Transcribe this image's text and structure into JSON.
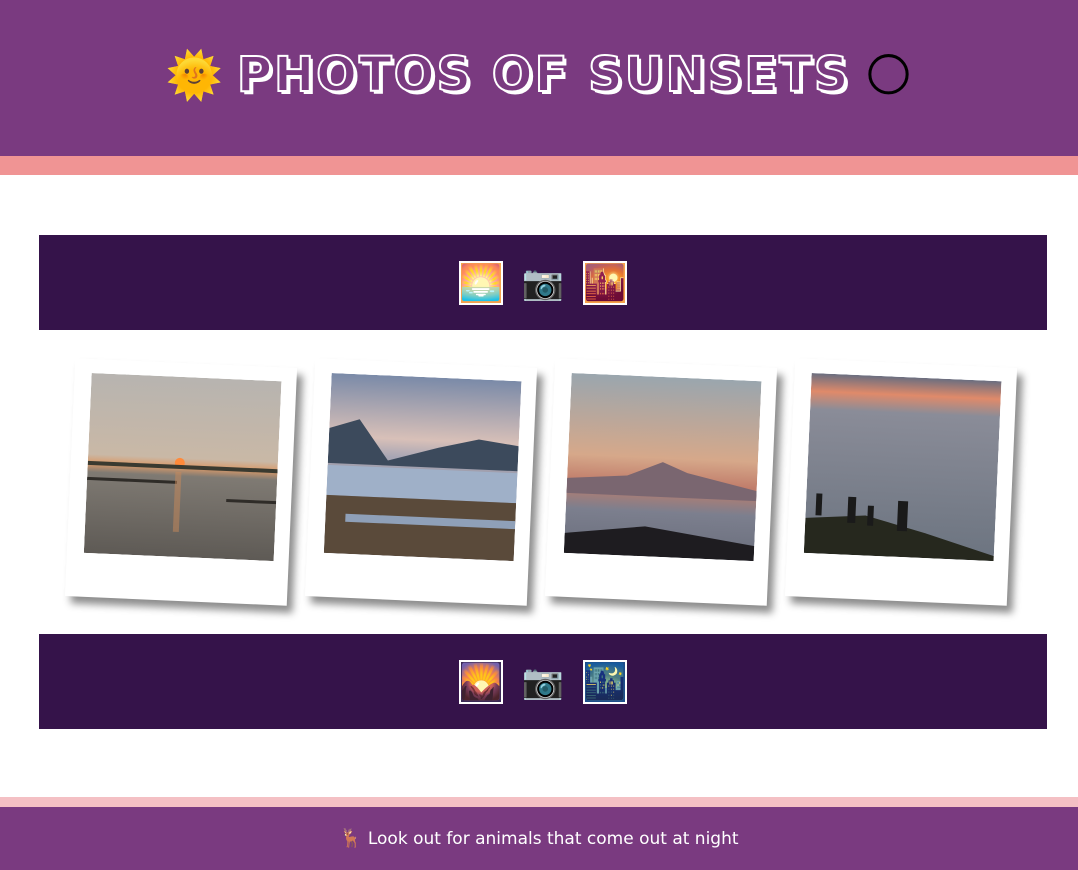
{
  "header": {
    "title": "PHOTOS OF SUNSETS",
    "left_icon": "🌞",
    "right_icon": "🌕"
  },
  "top_band": {
    "icons": [
      {
        "name": "sunrise-icon",
        "glyph": "🌅"
      },
      {
        "name": "camera-icon",
        "glyph": "📷"
      },
      {
        "name": "city-sunset-icon",
        "glyph": "🌇"
      }
    ]
  },
  "bottom_band": {
    "icons": [
      {
        "name": "sunrise-over-mountains-icon",
        "glyph": "🌄"
      },
      {
        "name": "camera-icon",
        "glyph": "📷"
      },
      {
        "name": "night-city-icon",
        "glyph": "🌃"
      }
    ]
  },
  "photos": [
    {
      "name": "photo-sunset-pier"
    },
    {
      "name": "photo-mountain-lake"
    },
    {
      "name": "photo-mountain-haze"
    },
    {
      "name": "photo-people-on-hill"
    }
  ],
  "footer": {
    "icon": "🦌",
    "text": "Look out for animals that come out at night"
  },
  "colors": {
    "header_bg": "#7a3a80",
    "header_stripe": "#f09494",
    "band_bg": "#35134a",
    "footer_stripe": "#f4c0c4"
  }
}
